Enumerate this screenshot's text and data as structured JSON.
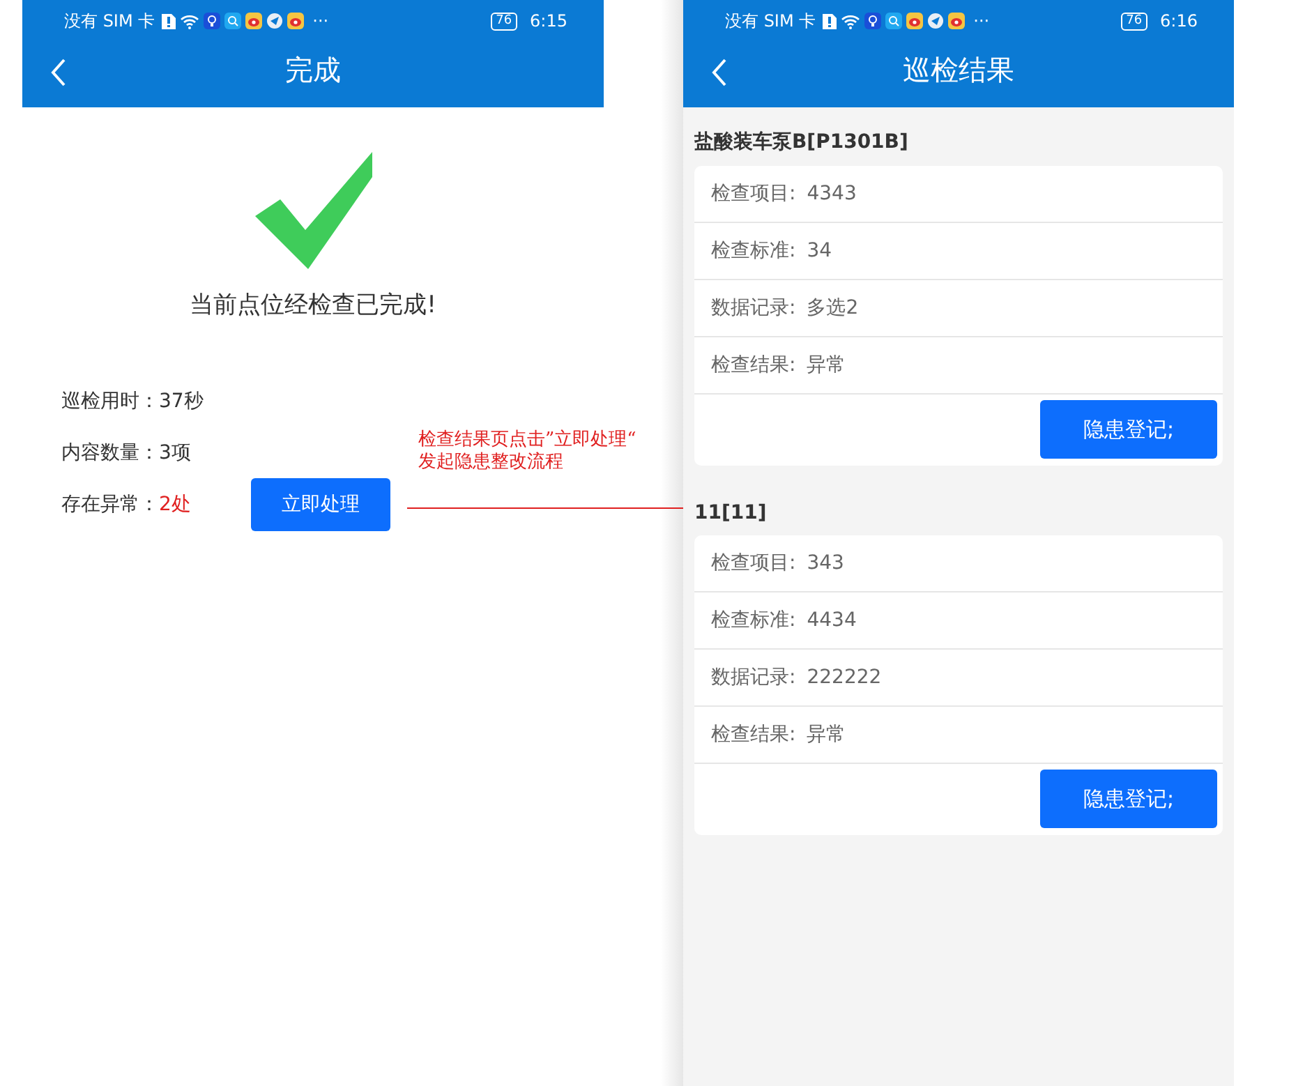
{
  "completion_screen": {
    "status_bar": {
      "carrier": "没有 SIM 卡",
      "more": "···",
      "battery": "76",
      "time": "6:15"
    },
    "title": "完成",
    "message": "当前点位经检查已完成!",
    "stats": [
      {
        "label": "巡检用时：",
        "value": "37秒",
        "kind": "normal"
      },
      {
        "label": "内容数量：",
        "value": "3项",
        "kind": "normal"
      },
      {
        "label": "存在异常：",
        "value": "2处",
        "kind": "alert"
      }
    ],
    "action_button": "立即处理"
  },
  "annotation": {
    "text": "检查结果页点击”立即处理“\n发起隐患整改流程"
  },
  "results_screen": {
    "status_bar": {
      "carrier": "没有 SIM 卡",
      "more": "···",
      "battery": "76",
      "time": "6:16"
    },
    "title": "巡检结果",
    "groups": [
      {
        "name": "盐酸装车泵B[P1301B]",
        "rows": [
          {
            "label": "检查项目:",
            "value": "4343"
          },
          {
            "label": "检查标准:",
            "value": "34"
          },
          {
            "label": "数据记录:",
            "value": "多选2"
          },
          {
            "label": "检查结果:",
            "value": "异常"
          }
        ],
        "button": "隐患登记;"
      },
      {
        "name": "11[11]",
        "rows": [
          {
            "label": "检查项目:",
            "value": "343"
          },
          {
            "label": "检查标准:",
            "value": "4434"
          },
          {
            "label": "数据记录:",
            "value": "222222"
          },
          {
            "label": "检查结果:",
            "value": "异常"
          }
        ],
        "button": "隐患登记;"
      }
    ]
  }
}
